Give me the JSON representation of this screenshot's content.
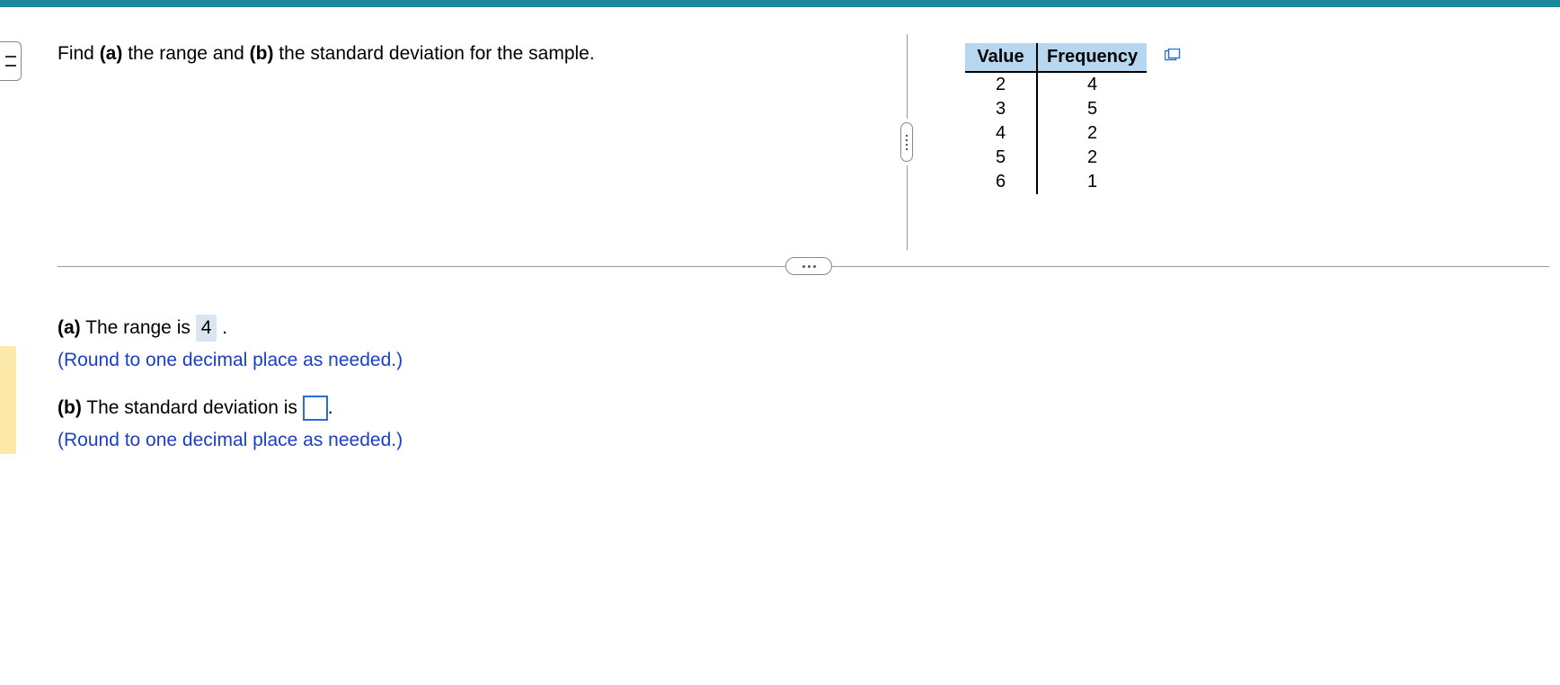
{
  "question": {
    "prefix": "Find ",
    "part_a_label": "(a)",
    "part_a_text": " the range and ",
    "part_b_label": "(b)",
    "part_b_text": " the standard deviation for the sample."
  },
  "table": {
    "headers": {
      "value": "Value",
      "frequency": "Frequency"
    },
    "rows": [
      {
        "value": "2",
        "frequency": "4"
      },
      {
        "value": "3",
        "frequency": "5"
      },
      {
        "value": "4",
        "frequency": "2"
      },
      {
        "value": "5",
        "frequency": "2"
      },
      {
        "value": "6",
        "frequency": "1"
      }
    ]
  },
  "answers": {
    "a": {
      "label": "(a)",
      "text_before": " The range is ",
      "value": "4",
      "text_after": " .",
      "note": "(Round to one decimal place as needed.)"
    },
    "b": {
      "label": "(b)",
      "text_before": " The standard deviation is ",
      "value": "",
      "text_after": ".",
      "note": "(Round to one decimal place as needed.)"
    }
  }
}
